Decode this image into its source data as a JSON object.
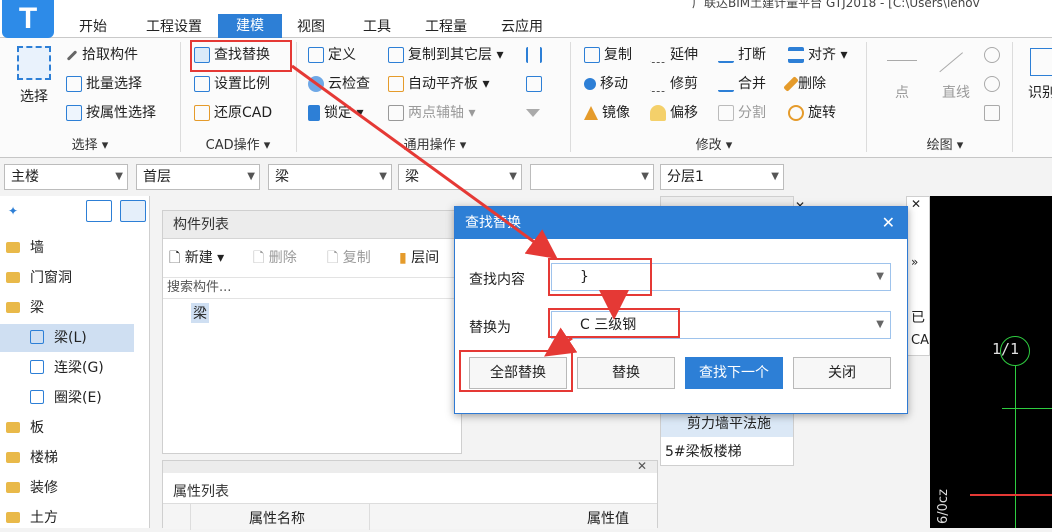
{
  "title": {
    "text": "广联达BIM土建计量平台 GTJ2018 - [C:\\Users\\lenov"
  },
  "app_logo": "T",
  "menu": {
    "tabs": [
      "开始",
      "工程设置",
      "建模",
      "视图",
      "工具",
      "工程量",
      "云应用"
    ],
    "active": "建模"
  },
  "ribbon": {
    "select": {
      "big_label": "选择",
      "pick": "拾取构件",
      "batch": "批量选择",
      "by_attr": "按属性选择",
      "group": "选择 ▾"
    },
    "cad": {
      "find_replace": "查找替换",
      "set_scale": "设置比例",
      "restore_cad": "还原CAD",
      "group": "CAD操作 ▾"
    },
    "general": {
      "define": "定义",
      "cloud_check": "云检查",
      "lock": "锁定 ▾",
      "copy_to_floor": "复制到其它层 ▾",
      "auto_align": "自动平齐板 ▾",
      "two_point_axis": "两点辅轴 ▾",
      "group": "通用操作 ▾"
    },
    "modify": {
      "copy": "复制",
      "extend": "延伸",
      "break": "打断",
      "align": "对齐 ▾",
      "move": "移动",
      "trim": "修剪",
      "merge": "合并",
      "delete": "删除",
      "mirror": "镜像",
      "offset": "偏移",
      "split": "分割",
      "rotate": "旋转",
      "group": "修改 ▾"
    },
    "draw": {
      "point": "点",
      "line": "直线",
      "group": "绘图 ▾"
    },
    "recognize": {
      "label": "识别"
    }
  },
  "dropdowns": [
    "主楼",
    "首层",
    "梁",
    "梁",
    "",
    "分层1"
  ],
  "tree": {
    "items": [
      {
        "label": "墙",
        "type": "folder"
      },
      {
        "label": "门窗洞",
        "type": "folder"
      },
      {
        "label": "梁",
        "type": "folder-open"
      },
      {
        "label": "梁(L)",
        "type": "child",
        "selected": true
      },
      {
        "label": "连梁(G)",
        "type": "child"
      },
      {
        "label": "圈梁(E)",
        "type": "child"
      },
      {
        "label": "板",
        "type": "folder"
      },
      {
        "label": "楼梯",
        "type": "folder"
      },
      {
        "label": "装修",
        "type": "folder"
      },
      {
        "label": "土方",
        "type": "folder"
      }
    ]
  },
  "component_panel": {
    "title": "构件列表",
    "new": "新建 ▾",
    "delete": "删除",
    "copy": "复制",
    "floor_copy": "层间",
    "search_placeholder": "搜索构件...",
    "item": "梁"
  },
  "property_panel": {
    "title": "属性列表",
    "col_name": "属性名称",
    "col_value": "属性值"
  },
  "right_list": {
    "items": [
      "剪力墙平法施",
      "5#梁板楼梯"
    ],
    "tag1": "已",
    "tag2": "CA"
  },
  "canvas": {
    "axis_label": "1/1",
    "bottom_text": "6/0cz"
  },
  "dialog": {
    "title": "查找替换",
    "find_label": "查找内容",
    "find_value": "}",
    "replace_label": "替换为",
    "replace_value": "C 三级钢",
    "btn_replace_all": "全部替换",
    "btn_replace": "替换",
    "btn_find_next": "查找下一个",
    "btn_close": "关闭"
  },
  "colors": {
    "accent": "#2d7fd6",
    "highlight": "#e53935"
  }
}
